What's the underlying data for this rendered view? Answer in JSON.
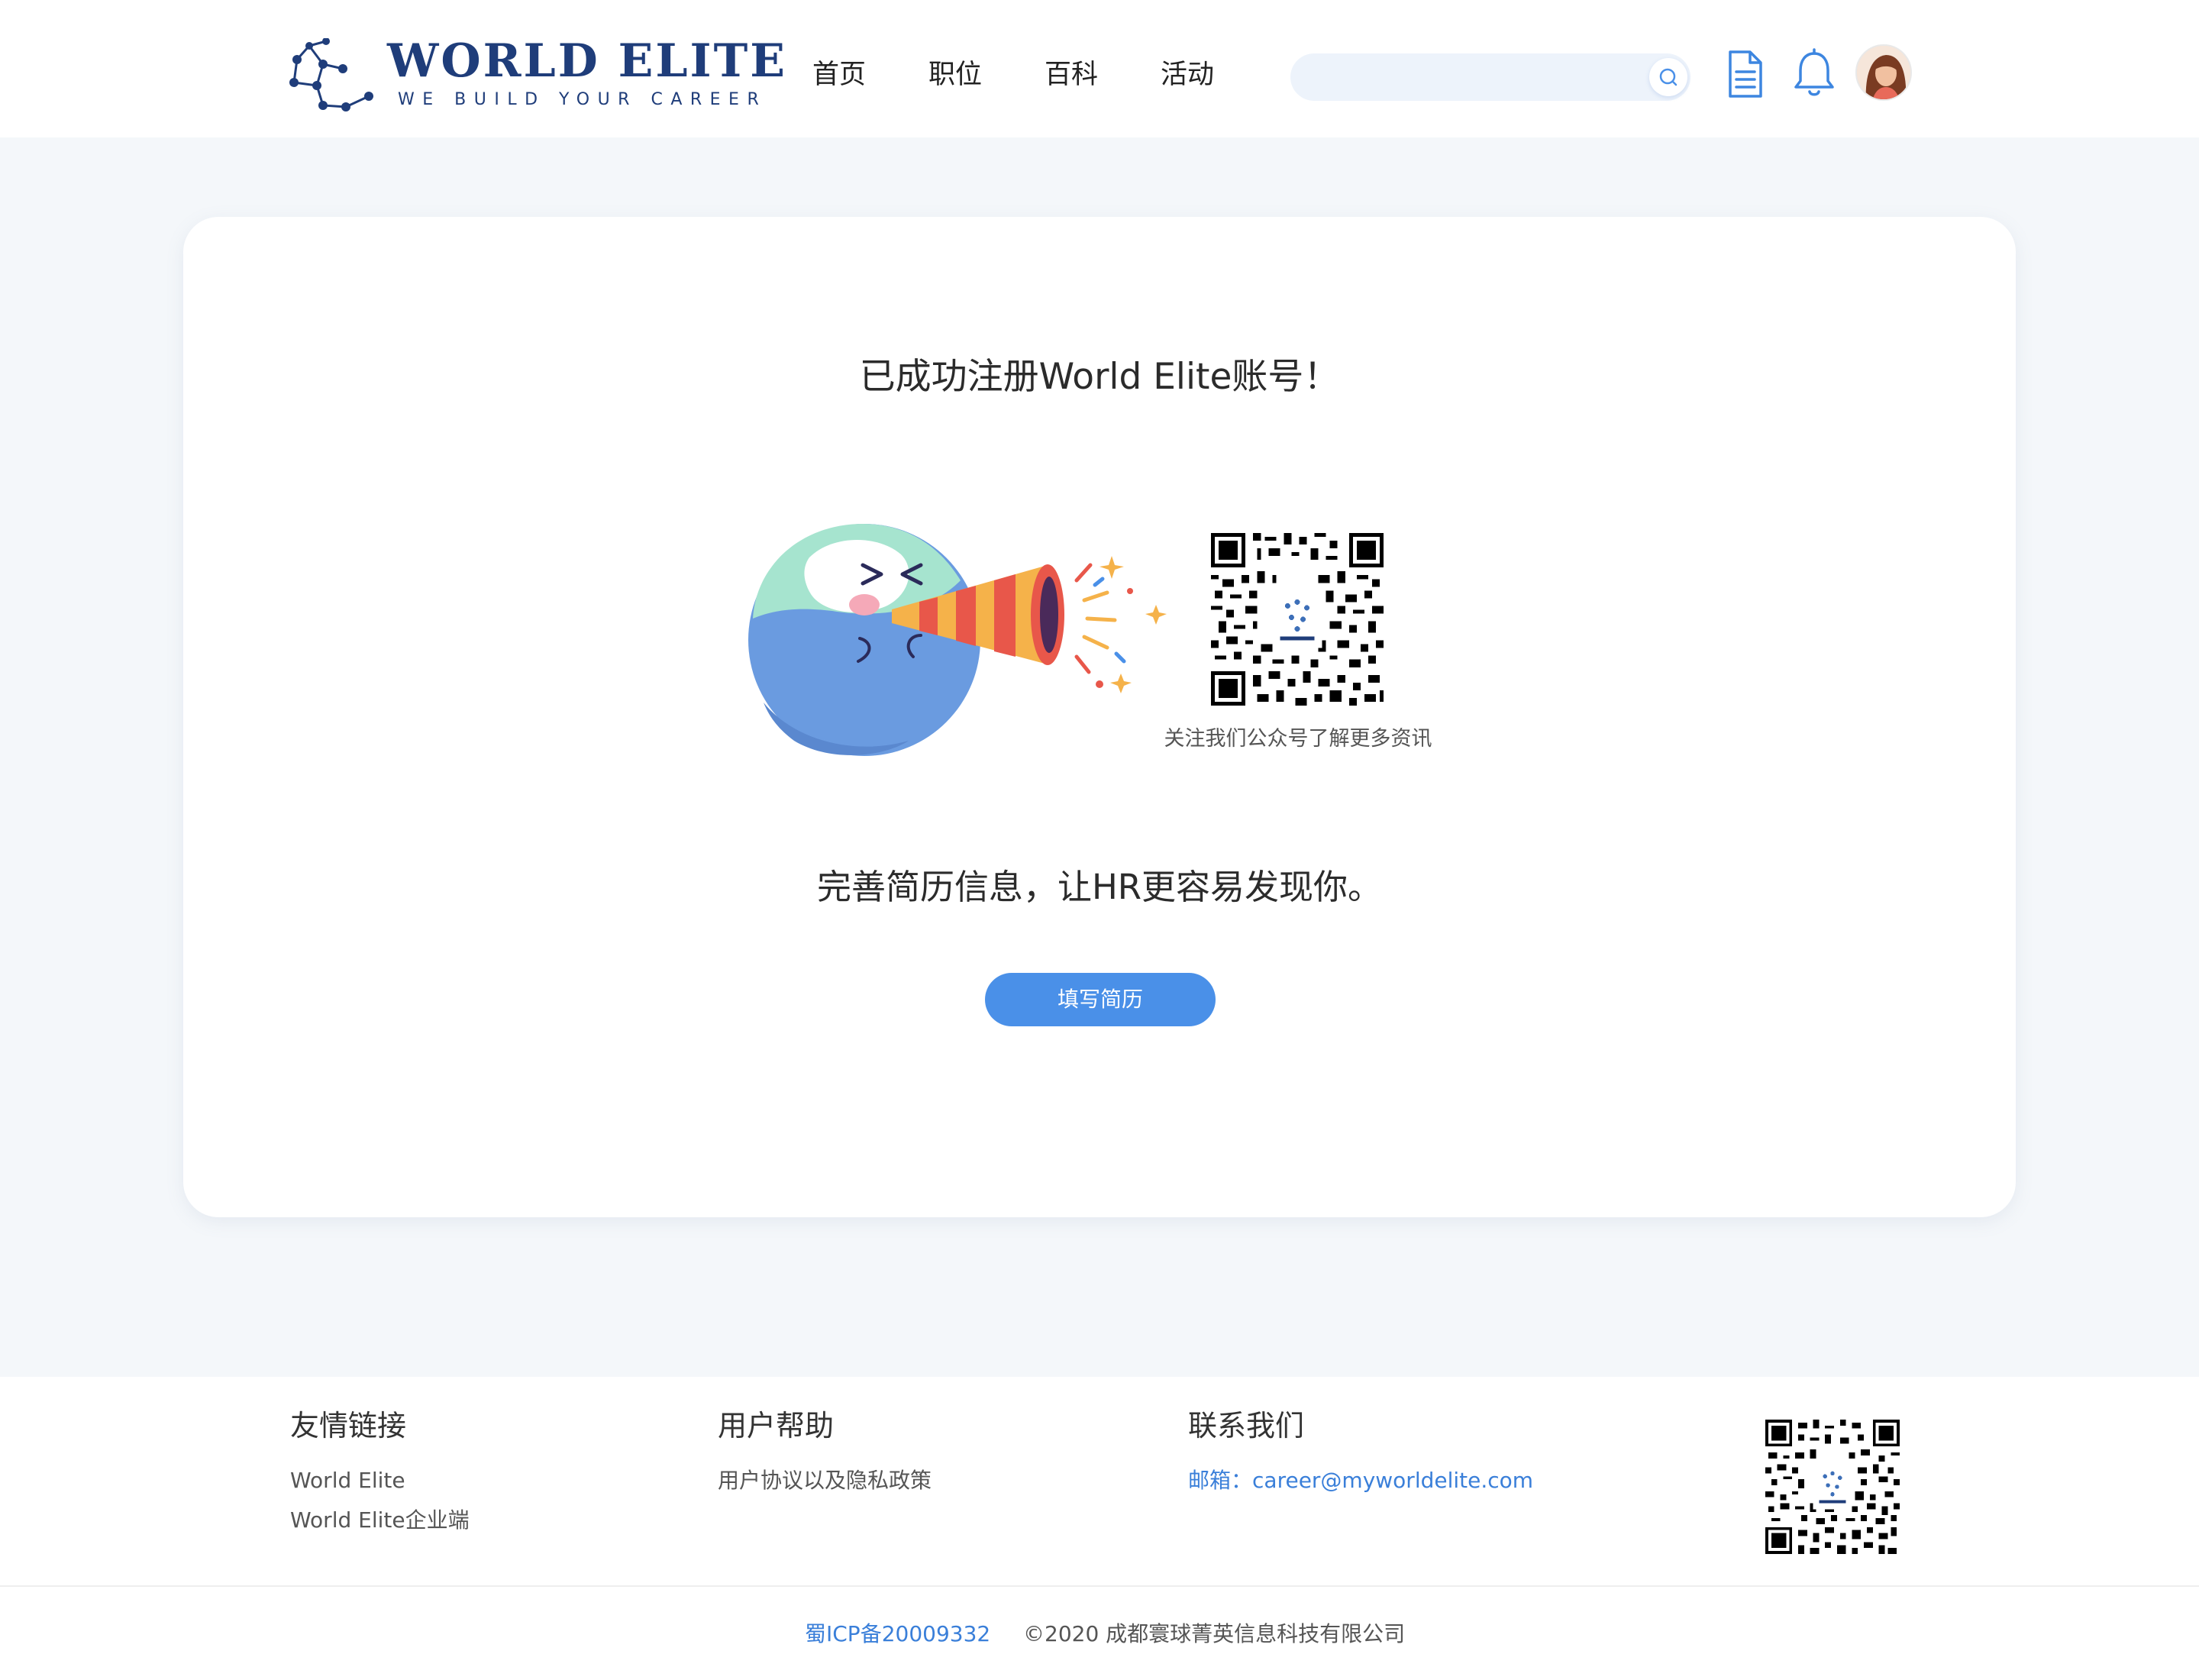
{
  "brand": {
    "title": "WORLD ELITE",
    "tagline": "WE BUILD YOUR CAREER",
    "color": "#1f3d7a"
  },
  "nav": {
    "items": [
      {
        "label": "首页"
      },
      {
        "label": "职位"
      },
      {
        "label": "百科"
      },
      {
        "label": "活动"
      }
    ]
  },
  "search": {
    "value": "",
    "placeholder": ""
  },
  "header_icons": {
    "resume": "document-icon",
    "notifications": "bell-icon",
    "avatar": "user-avatar"
  },
  "card": {
    "success_title": "已成功注册World Elite账号！",
    "qr_caption": "关注我们公众号了解更多资讯",
    "tip": "完善简历信息，让HR更容易发现你。",
    "fill_button": "填写简历"
  },
  "footer": {
    "links_title": "友情链接",
    "links": [
      "World Elite",
      "World Elite企业端"
    ],
    "help_title": "用户帮助",
    "help_links": [
      "用户协议以及隐私政策"
    ],
    "contact_title": "联系我们",
    "email_label": "邮箱：",
    "email_value": "career@myworldelite.com",
    "icp": "蜀ICP备20009332",
    "copyright": "©2020 成都寰球菁英信息科技有限公司"
  },
  "colors": {
    "accent": "#4a90e8",
    "page_bg": "#f4f7fa",
    "link": "#3a7fd9"
  }
}
